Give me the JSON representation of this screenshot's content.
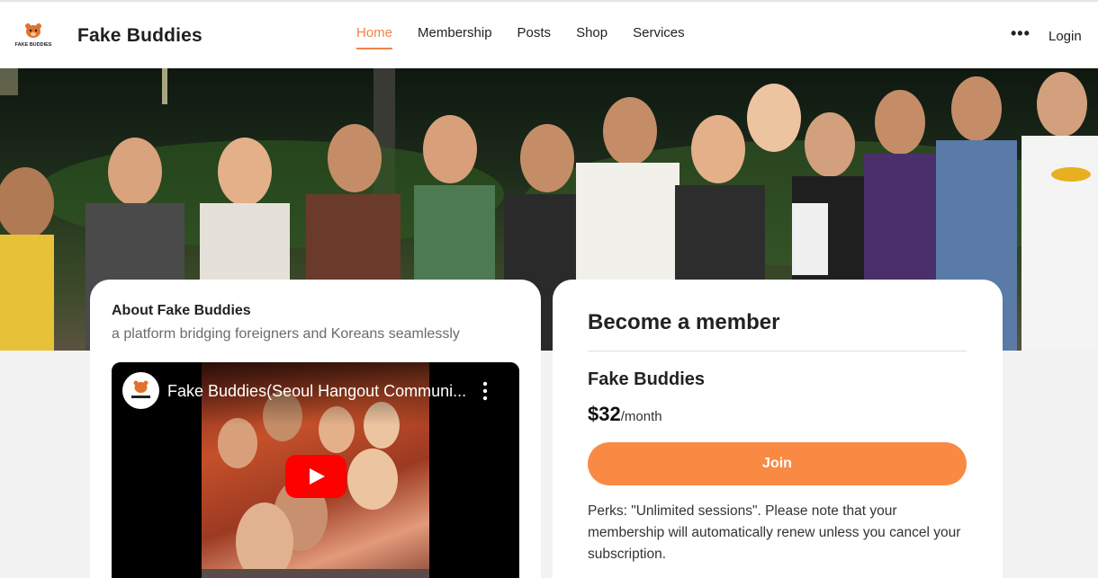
{
  "header": {
    "logo_icon": "bear-mascot-logo",
    "logo_text": "FAKE BUDDIES",
    "brand": "Fake Buddies",
    "nav": [
      {
        "label": "Home",
        "active": true
      },
      {
        "label": "Membership",
        "active": false
      },
      {
        "label": "Posts",
        "active": false
      },
      {
        "label": "Shop",
        "active": false
      },
      {
        "label": "Services",
        "active": false
      }
    ],
    "more_icon": "more-horizontal-icon",
    "more_label": "•••",
    "login_label": "Login"
  },
  "hero": {
    "image_icon": "group-photo"
  },
  "about": {
    "title": "About Fake Buddies",
    "subtitle": "a platform bridging foreigners and Koreans seamlessly",
    "video": {
      "title": "Fake Buddies(Seoul Hangout Communi...",
      "channel_icon": "channel-avatar-icon",
      "menu_icon": "kebab-menu-icon",
      "play_icon": "youtube-play-icon"
    }
  },
  "membership": {
    "heading": "Become a member",
    "plan_name": "Fake Buddies",
    "price": "$32",
    "price_unit": "/month",
    "join_label": "Join",
    "perks": "Perks: \"Unlimited sessions\". Please note that your membership will automatically renew unless you cancel your subscription."
  },
  "colors": {
    "accent": "#f98a44",
    "nav_active": "#f0844a",
    "youtube_red": "#ff0000"
  }
}
